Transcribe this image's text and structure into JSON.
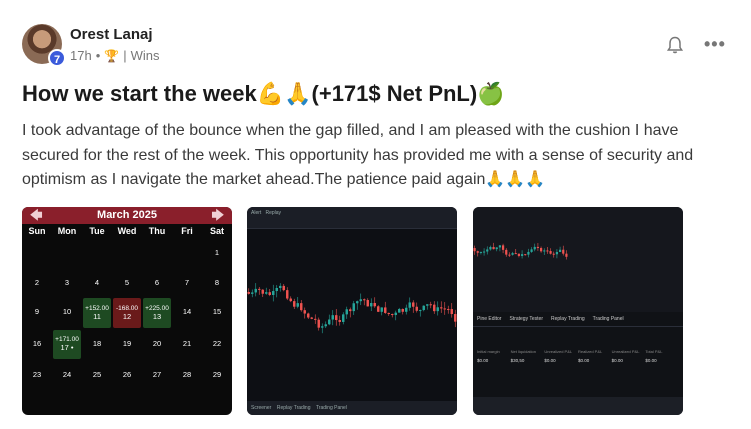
{
  "post": {
    "author": "Orest Lanaj",
    "level": "7",
    "time": "17h",
    "separator": "•",
    "category": "Wins",
    "title": "How we start the week💪🙏(+171$ Net PnL)🍏",
    "body": "I took advantage of the bounce when the gap filled, and I am pleased with the cushion I have secured for the rest of the week. This opportunity has provided me with a sense of security and optimism as I navigate the market ahead.The patience paid again🙏🙏🙏"
  },
  "calendar": {
    "month": "March 2025",
    "days_of_week": [
      "Sun",
      "Mon",
      "Tue",
      "Wed",
      "Thu",
      "Fri",
      "Sat"
    ],
    "rows": [
      [
        {
          "d": ""
        },
        {
          "d": ""
        },
        {
          "d": ""
        },
        {
          "d": ""
        },
        {
          "d": ""
        },
        {
          "d": ""
        },
        {
          "d": "1"
        }
      ],
      [
        {
          "d": "2"
        },
        {
          "d": "3"
        },
        {
          "d": "4"
        },
        {
          "d": "5"
        },
        {
          "d": "6"
        },
        {
          "d": "7"
        },
        {
          "d": "8"
        }
      ],
      [
        {
          "d": "9"
        },
        {
          "d": "10"
        },
        {
          "d": "11",
          "pnl": "+152.00",
          "tone": "green"
        },
        {
          "d": "12",
          "pnl": "-168.00",
          "tone": "red"
        },
        {
          "d": "13",
          "pnl": "+225.00",
          "tone": "green"
        },
        {
          "d": "14"
        },
        {
          "d": "15"
        }
      ],
      [
        {
          "d": "16"
        },
        {
          "d": "17 •",
          "pnl": "+171.00",
          "tone": "green"
        },
        {
          "d": "18"
        },
        {
          "d": "19"
        },
        {
          "d": "20"
        },
        {
          "d": "21"
        },
        {
          "d": "22"
        }
      ],
      [
        {
          "d": "23"
        },
        {
          "d": "24"
        },
        {
          "d": "25"
        },
        {
          "d": "26"
        },
        {
          "d": "27"
        },
        {
          "d": "28"
        },
        {
          "d": "29"
        }
      ]
    ]
  },
  "chart2": {
    "toolbar_items": [
      "Alert",
      "Replay"
    ],
    "bottom_items": [
      "Screener",
      "Replay Trading",
      "Trading Panel"
    ]
  },
  "chart3": {
    "tabs": [
      "Pine Editor",
      "Strategy Tester",
      "Replay Trading",
      "Trading Panel"
    ],
    "headers": [
      "Initial margin",
      "Net liquidation",
      "Unrealized P&L",
      "Realized P&L",
      "Unrealized P&L",
      "Total P&L"
    ],
    "values": [
      "$0.00",
      "$30,50",
      "$0.00",
      "$0.00",
      "$0.00",
      "$0.00"
    ]
  },
  "colors": {
    "calendar_header": "#8a1f2b",
    "profit": "#1e4a22",
    "loss": "#6a1a1a",
    "level_badge": "#3b5bdb"
  }
}
